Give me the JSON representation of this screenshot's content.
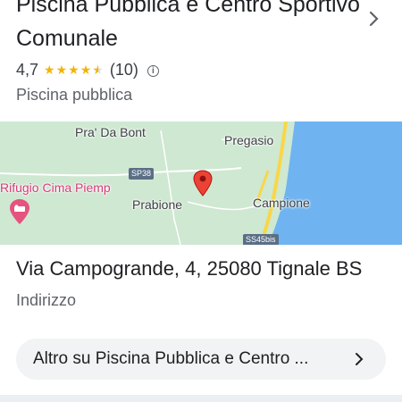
{
  "header": {
    "title": "Piscina Pubblica e Centro Sportivo Comunale",
    "rating": "4,7",
    "stars_icon": "star-rating-4.5",
    "stars_filled": 4.5,
    "stars_max": 5,
    "review_count": "(10)",
    "info_icon": "info-icon",
    "category": "Piscina pubblica"
  },
  "map": {
    "labels": {
      "pra_da_bont": "Pra' Da Bont",
      "pregasio": "Pregasio",
      "sp38": "SP38",
      "rifugio": "Rifugio Cima Piemp",
      "prabione": "Prabione",
      "campione": "Campione",
      "ss45bis": "SS45bis"
    },
    "colors": {
      "land": "#cfe8d2",
      "water": "#6fb4f1",
      "road": "#f9d649",
      "pin": "#ea4335",
      "poi": "#e5537f"
    }
  },
  "address": {
    "value": "Via Campogrande, 4, 25080 Tignale BS",
    "label": "Indirizzo"
  },
  "more_button": {
    "label": "Altro su Piscina Pubblica e Centro ...",
    "icon": "chevron-right-icon"
  }
}
